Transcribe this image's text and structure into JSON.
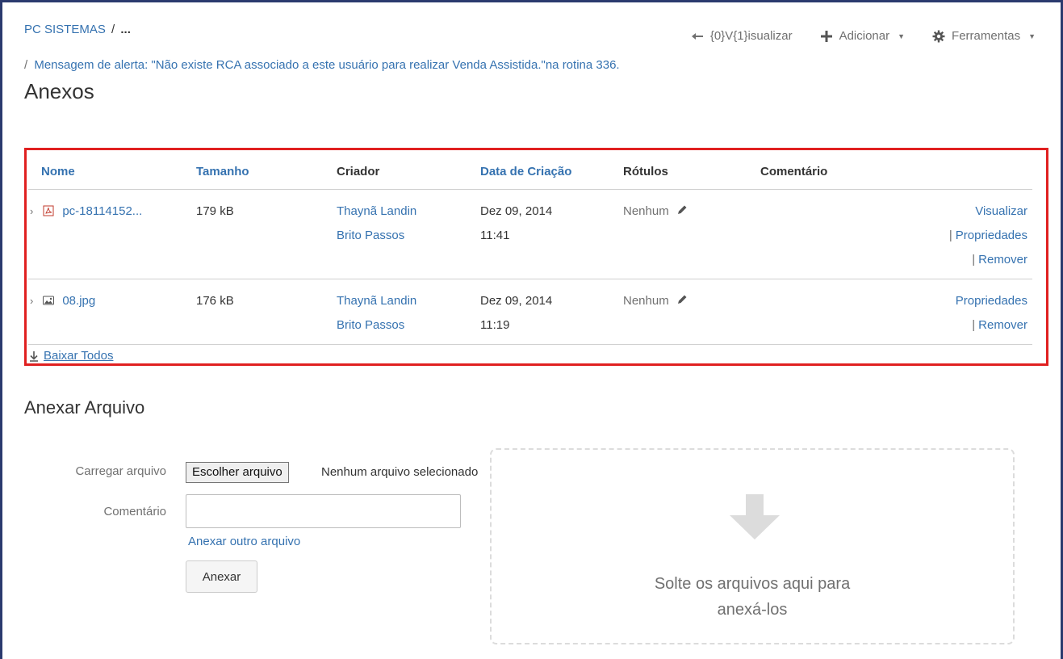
{
  "breadcrumb": {
    "root": "PC SISTEMAS",
    "separator": "/",
    "ellipsis": "...",
    "current_sep": "/",
    "current": "Mensagem de alerta: \"Não existe RCA associado a este usuário para realizar Venda Assistida.\"na rotina 336."
  },
  "page": {
    "title": "Anexos"
  },
  "toolbar": {
    "view": "{0}V{1}isualizar",
    "add": "Adicionar",
    "tools": "Ferramentas"
  },
  "table": {
    "headers": {
      "name": "Nome",
      "size": "Tamanho",
      "creator": "Criador",
      "date": "Data de Criação",
      "labels": "Rótulos",
      "comment": "Comentário"
    },
    "rows": [
      {
        "name": "pc-18114152...",
        "icon": "pdf-icon",
        "size": "179 kB",
        "creator_first": "Thaynã Landin",
        "creator_last": "Brito Passos",
        "date": "Dez 09, 2014",
        "time": "11:41",
        "labels": "Nenhum",
        "comment": "",
        "actions": [
          "Visualizar",
          "Propriedades",
          "Remover"
        ]
      },
      {
        "name": "08.jpg",
        "icon": "image-icon",
        "size": "176 kB",
        "creator_first": "Thaynã Landin",
        "creator_last": "Brito Passos",
        "date": "Dez 09, 2014",
        "time": "11:19",
        "labels": "Nenhum",
        "comment": "",
        "actions": [
          "Propriedades",
          "Remover"
        ]
      }
    ],
    "download_all": "Baixar Todos"
  },
  "upload": {
    "title": "Anexar Arquivo",
    "file_label": "Carregar arquivo",
    "file_button": "Escolher arquivo",
    "file_status": "Nenhum arquivo selecionado",
    "comment_label": "Comentário",
    "comment_value": "",
    "another_file": "Anexar outro arquivo",
    "submit": "Anexar",
    "drop_line1": "Solte os arquivos aqui para",
    "drop_line2": "anexá-los"
  },
  "colors": {
    "link": "#3572b0",
    "highlight_border": "#e02020",
    "frame_border": "#2b3a6e"
  }
}
